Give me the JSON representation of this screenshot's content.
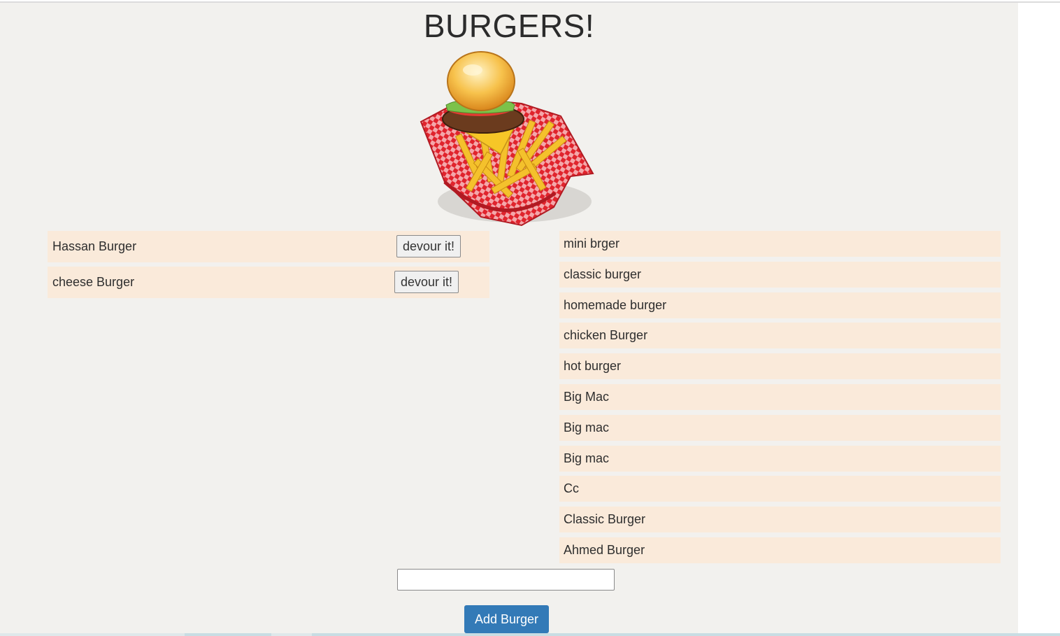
{
  "header": {
    "title": "BURGERS!"
  },
  "hero_image": {
    "icon": "burger-and-fries-basket-icon"
  },
  "not_devoured": [
    {
      "name": "Hassan Burger",
      "button_label": "devour it!"
    },
    {
      "name": "cheese Burger",
      "button_label": "devour it!"
    }
  ],
  "devoured": [
    "mini brger",
    "classic burger",
    "homemade burger",
    "chicken Burger",
    "hot burger",
    "Big Mac",
    "Big mac",
    "Big mac",
    "Cc",
    "Classic Burger",
    "Ahmed Burger"
  ],
  "form": {
    "input_value": "",
    "submit_label": "Add Burger"
  },
  "colors": {
    "page_bg": "#f2f1ee",
    "row_bg": "#faeada",
    "primary_button": "#337ab7"
  }
}
